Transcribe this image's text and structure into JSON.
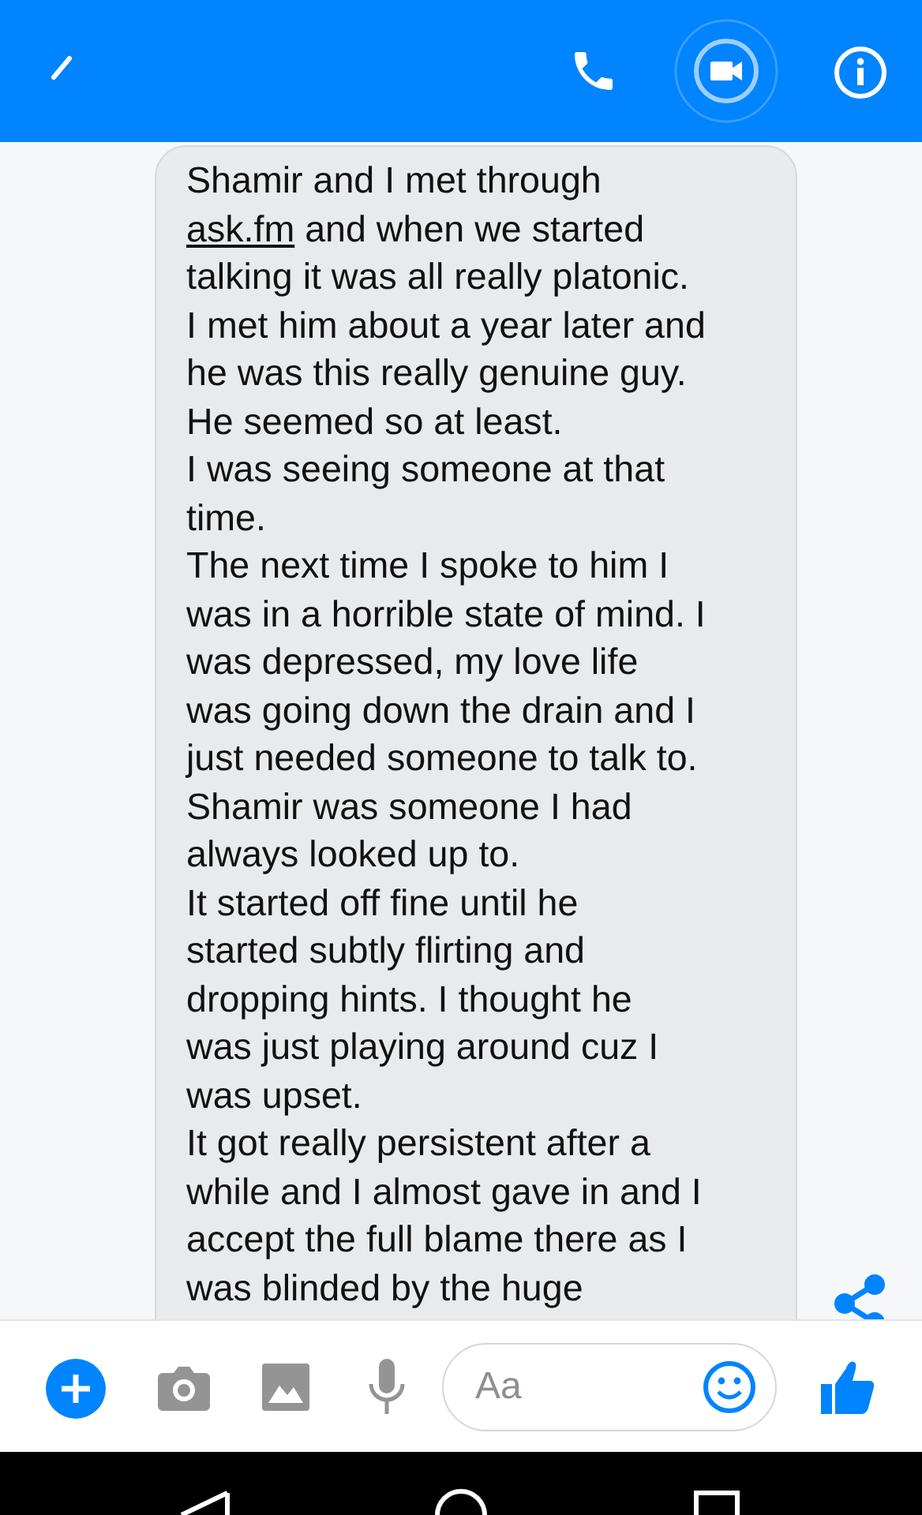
{
  "message": {
    "lines": [
      {
        "text": "Shamir and I met through"
      },
      {
        "link": "ask.fm",
        "text": " and when we started"
      },
      {
        "text": "talking it was all really platonic."
      },
      {
        "text": "I met him about a year later and"
      },
      {
        "text": "he was this really genuine guy."
      },
      {
        "text": "He seemed so at least."
      },
      {
        "text": "I was seeing someone at that"
      },
      {
        "text": "time."
      },
      {
        "text": "The next time I spoke to him I"
      },
      {
        "text": "was in a horrible state of mind. I"
      },
      {
        "text": "was depressed, my love life"
      },
      {
        "text": "was going down the drain and I"
      },
      {
        "text": "just needed someone to talk to."
      },
      {
        "text": "Shamir was someone I had"
      },
      {
        "text": "always looked up to."
      },
      {
        "text": "It started off fine until he"
      },
      {
        "text": "started subtly flirting and"
      },
      {
        "text": "dropping hints. I thought he"
      },
      {
        "text": "was just playing around cuz I"
      },
      {
        "text": "was upset."
      },
      {
        "text": "It got really persistent after a"
      },
      {
        "text": "while and I almost gave in and I"
      },
      {
        "text": "accept the full blame there as I"
      },
      {
        "text": "was blinded by the huge"
      }
    ]
  },
  "composer": {
    "placeholder": "Aa"
  }
}
